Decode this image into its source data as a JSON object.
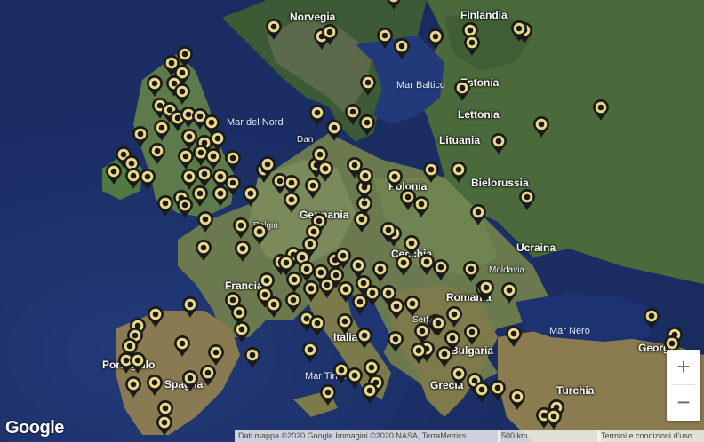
{
  "map": {
    "labels": {
      "norway": "Norvegia",
      "finland": "Finlandia",
      "baltic_sea": "Mar Baltico",
      "estonia": "Estonia",
      "latvia": "Lettonia",
      "north_sea": "Mar del Nord",
      "lithuania": "Lituania",
      "denmark": "Dan",
      "belarus": "Bielorussia",
      "poland": "Polonia",
      "germany": "Germania",
      "belgium": "Belgio",
      "czechia": "Cecchia",
      "ukraine": "Ucraina",
      "moldova": "Moldavia",
      "france": "Francia",
      "romania": "Romania",
      "serbia": "Serbia",
      "black_sea": "Mar Nero",
      "georgia": "Georgia",
      "bulgaria": "Bulgaria",
      "italy": "Italia",
      "portugal": "Portogallo",
      "spain": "Spagna",
      "tyrrhenian_sea": "Mar Tirreno",
      "greece": "Grecia",
      "turkey": "Turchia"
    },
    "marker_color": "#e8d88a",
    "marker_border": "#1a1a1a"
  },
  "footer": {
    "logo": "Google",
    "attribution": "Dati mappa ©2020 Google Immagini ©2020 NASA, TerraMetrics",
    "scale": "500 km",
    "terms": "Termini e condizioni d'uso"
  },
  "controls": {
    "zoom_in": "+",
    "zoom_out": "−"
  }
}
